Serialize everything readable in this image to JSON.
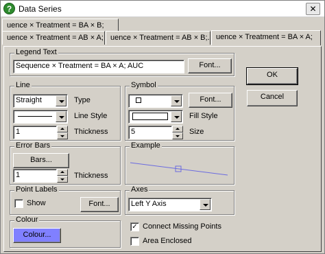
{
  "window": {
    "title": "Data Series",
    "icon": "help-question-icon",
    "close_label": "✕"
  },
  "tabs": [
    {
      "label": "uence × Treatment = BA × B;"
    },
    {
      "label": "uence × Treatment = AB × A;"
    },
    {
      "label": "uence × Treatment = AB × B;."
    },
    {
      "label": "uence × Treatment = BA × A;"
    }
  ],
  "legend_text": {
    "label": "Legend Text",
    "value": "Sequence × Treatment = BA × A; AUC",
    "font_button": "Font..."
  },
  "line": {
    "label": "Line",
    "type_value": "Straight",
    "type_label": "Type",
    "style_label": "Line Style",
    "thickness_value": "1",
    "thickness_label": "Thickness"
  },
  "symbol": {
    "label": "Symbol",
    "font_button": "Font...",
    "fill_label": "Fill Style",
    "size_value": "5",
    "size_label": "Size"
  },
  "error_bars": {
    "label": "Error Bars",
    "bars_button": "Bars...",
    "thickness_value": "1",
    "thickness_label": "Thickness"
  },
  "example": {
    "label": "Example"
  },
  "point_labels": {
    "label": "Point Labels",
    "show_label": "Show",
    "show_checked": false,
    "font_button": "Font..."
  },
  "axes": {
    "label": "Axes",
    "value": "Left Y Axis"
  },
  "colour": {
    "label": "Colour",
    "button": "Colour...",
    "swatch": "#8080ff"
  },
  "options": {
    "connect_label": "Connect Missing Points",
    "connect_checked": true,
    "area_label": "Area Enclosed",
    "area_checked": false
  },
  "actions": {
    "ok": "OK",
    "cancel": "Cancel"
  }
}
